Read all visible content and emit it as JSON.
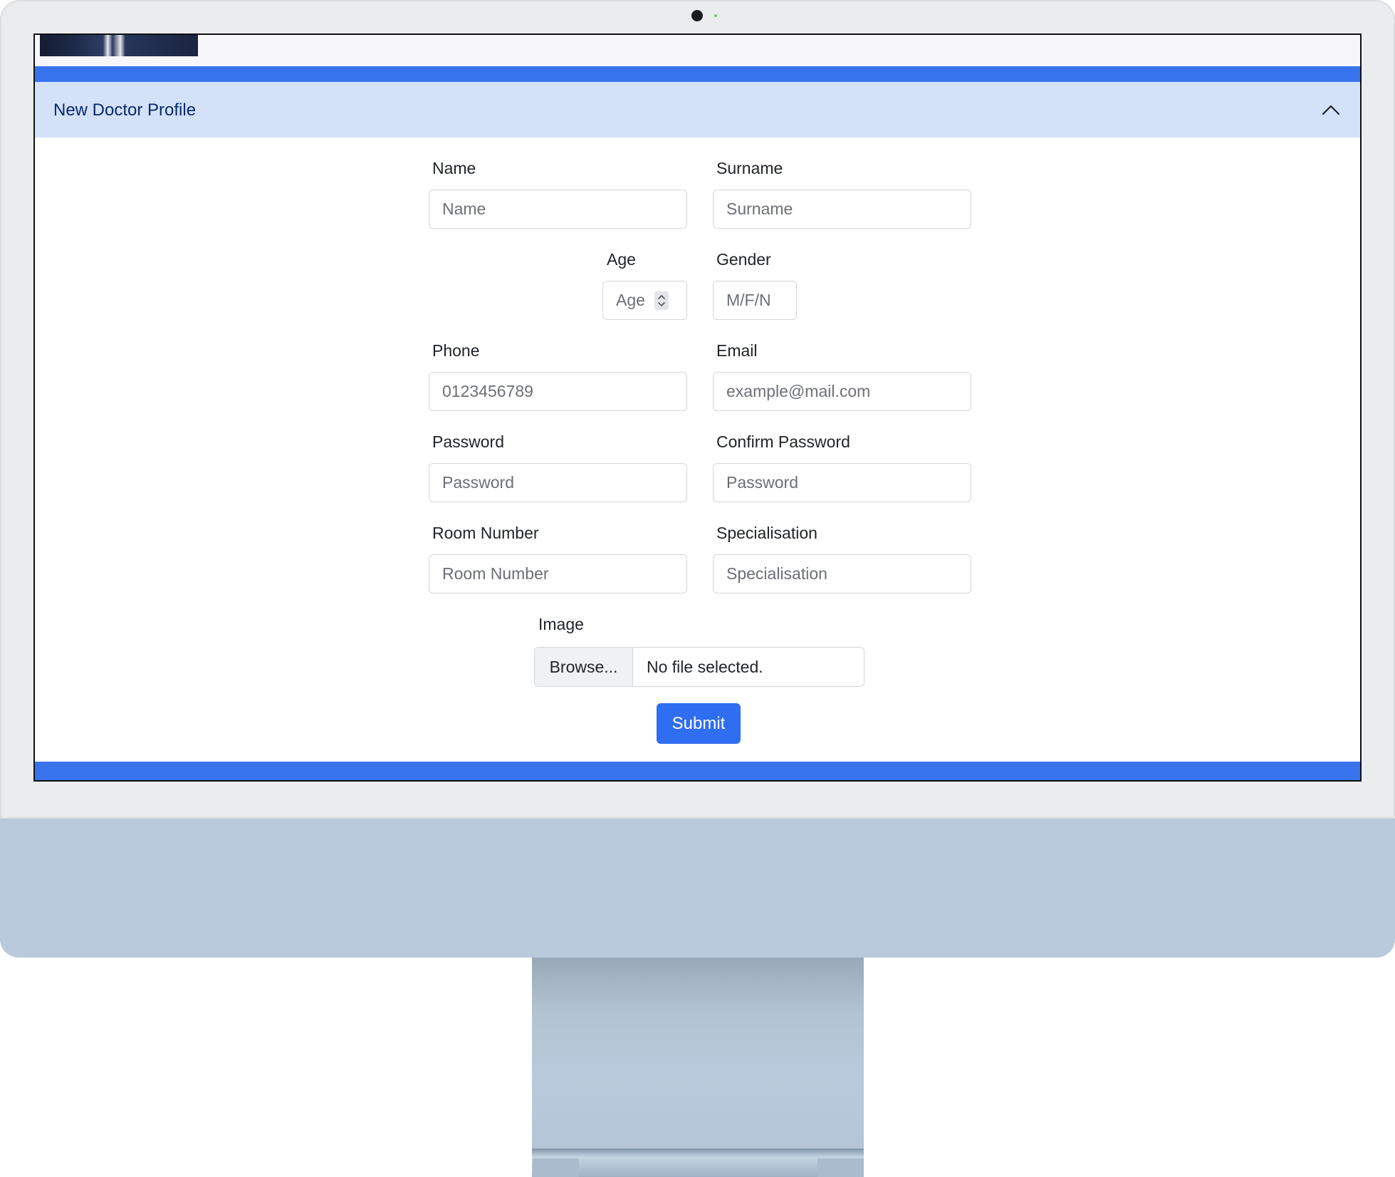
{
  "accordion": {
    "title": "New Doctor Profile"
  },
  "form": {
    "name": {
      "label": "Name",
      "placeholder": "Name"
    },
    "surname": {
      "label": "Surname",
      "placeholder": "Surname"
    },
    "age": {
      "label": "Age",
      "placeholder": "Age"
    },
    "gender": {
      "label": "Gender",
      "placeholder": "M/F/N"
    },
    "phone": {
      "label": "Phone",
      "placeholder": "0123456789"
    },
    "email": {
      "label": "Email",
      "placeholder": "example@mail.com"
    },
    "password": {
      "label": "Password",
      "placeholder": "Password"
    },
    "confirm_password": {
      "label": "Confirm Password",
      "placeholder": "Password"
    },
    "room_number": {
      "label": "Room Number",
      "placeholder": "Room Number"
    },
    "specialisation": {
      "label": "Specialisation",
      "placeholder": "Specialisation"
    },
    "image": {
      "label": "Image",
      "browse_label": "Browse...",
      "status": "No file selected."
    },
    "submit_label": "Submit"
  },
  "colors": {
    "accent": "#3773ed",
    "accordion_bg": "#d3e1f9",
    "accordion_title": "#082a6b",
    "monitor_chin": "#b8cadb"
  },
  "icons": {
    "accordion_toggle": "chevron-up-icon",
    "age_stepper": "stepper-icon"
  }
}
